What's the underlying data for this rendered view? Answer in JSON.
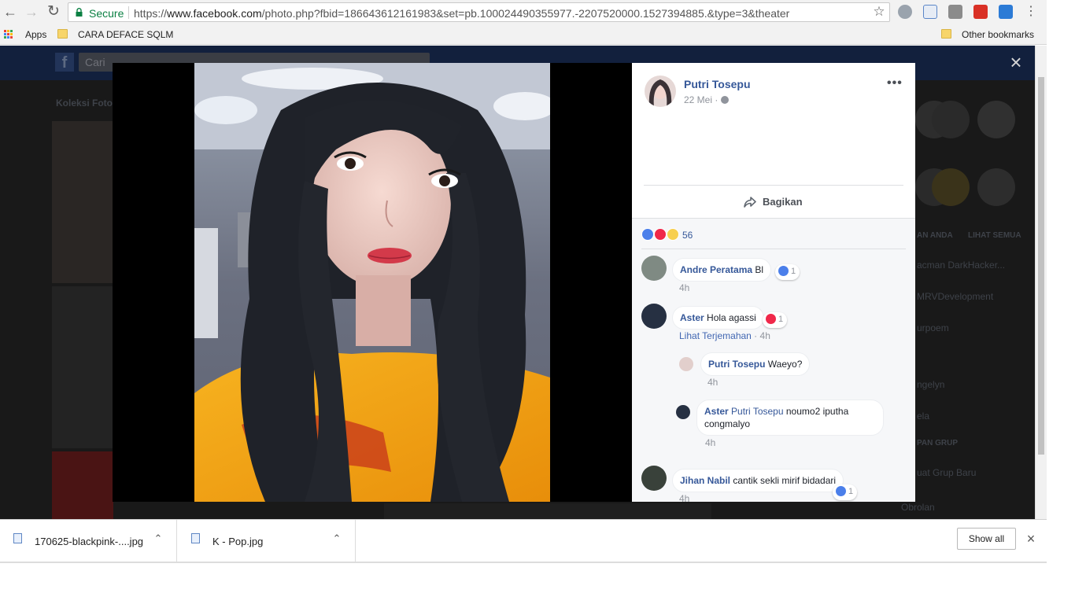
{
  "browser": {
    "secure_label": "Secure",
    "url_scheme": "https://",
    "url_host": "www.facebook.com",
    "url_path": "/photo.php?fbid=186643612161983&set=pb.100024490355977.-2207520000.1527394885.&type=3&theater"
  },
  "bookmarks": {
    "apps_label": "Apps",
    "items": [
      "CARA DEFACE SQLM"
    ],
    "other_label": "Other bookmarks"
  },
  "background_page": {
    "search_placeholder": "Cari",
    "collection_heading": "Koleksi Foto",
    "right_labels": [
      "AN ANDA",
      "LIHAT SEMUA",
      "acman DarkHacker...",
      "MRVDevelopment",
      "urpoem",
      "ngelyn",
      "ela",
      "PAN GRUP",
      "uat Grup Baru",
      "Obrolan"
    ]
  },
  "post": {
    "author": "Putri Tosepu",
    "date": "22 Mei ·",
    "share_label": "Bagikan",
    "reaction_count": "56"
  },
  "comments": [
    {
      "name": "Andre Peratama",
      "text": "Bl",
      "time": "4h",
      "reaction_count": "1"
    },
    {
      "name": "Aster",
      "text": "Hola agassi",
      "translate": "Lihat Terjemahan",
      "time": "4h",
      "reaction_count": "1"
    },
    {
      "name": "Putri Tosepu",
      "text": "Waeyo?",
      "time": "4h"
    },
    {
      "name": "Aster",
      "mention": "Putri Tosepu",
      "text": "noumo2 iputha congmalyo",
      "time": "4h"
    },
    {
      "name": "Jihan Nabil",
      "text": "cantik sekli mirif bidadari",
      "time": "4h",
      "reaction_count": "1"
    }
  ],
  "downloads": {
    "items": [
      "170625-blackpink-....jpg",
      "K - Pop.jpg"
    ],
    "show_all": "Show all"
  },
  "colors": {
    "fb_link": "#365899",
    "secure_green": "#0b8043",
    "like_blue": "#4b7fea",
    "love_red": "#f0284a",
    "wow_yellow": "#f7cf4f"
  }
}
